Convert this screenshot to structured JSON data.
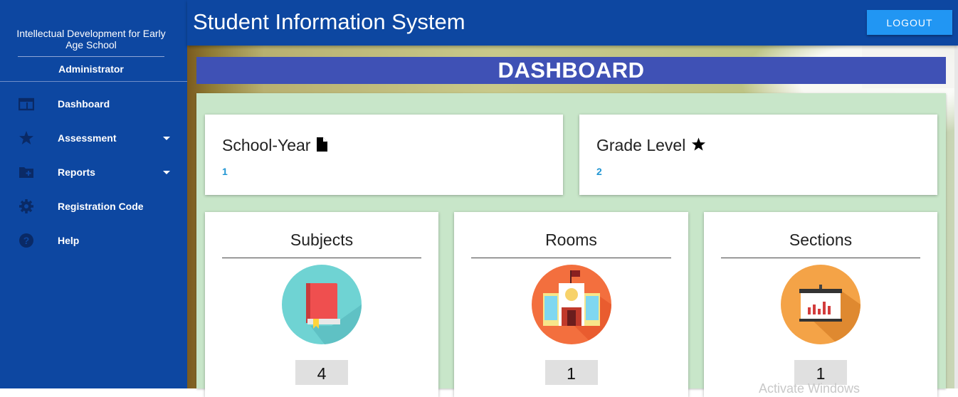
{
  "sidebar": {
    "school_name": "Intellectual Development for Early Age School",
    "role": "Administrator",
    "items": [
      {
        "label": "Dashboard",
        "icon": "dashboard-icon"
      },
      {
        "label": "Assessment",
        "icon": "star-icon",
        "has_submenu": true
      },
      {
        "label": "Reports",
        "icon": "folder-add-icon",
        "has_submenu": true
      },
      {
        "label": "Registration Code",
        "icon": "gear-icon"
      },
      {
        "label": "Help",
        "icon": "help-icon"
      }
    ]
  },
  "header": {
    "title": "Student Information System",
    "logout_label": "LOGOUT"
  },
  "main": {
    "banner": "DASHBOARD",
    "summary_cards": [
      {
        "title": "School-Year",
        "icon": "document-icon",
        "value": "1"
      },
      {
        "title": "Grade Level",
        "icon": "star-icon",
        "value": "2"
      }
    ],
    "stat_cards": [
      {
        "title": "Subjects",
        "icon": "book-icon",
        "count": "4"
      },
      {
        "title": "Rooms",
        "icon": "school-building-icon",
        "count": "1"
      },
      {
        "title": "Sections",
        "icon": "presentation-board-icon",
        "count": "1"
      }
    ]
  },
  "colors": {
    "sidebar_bg": "#0d47a1",
    "banner_bg": "#3f51b5",
    "panel_bg": "#c8e6c9",
    "accent": "#2196f3",
    "value_text": "#2196d3"
  }
}
